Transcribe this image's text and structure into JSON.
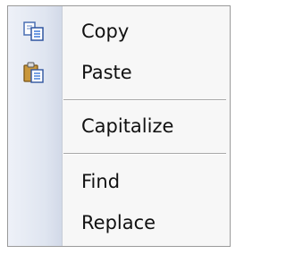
{
  "context_menu": {
    "items": [
      {
        "label": "Copy",
        "icon": "copy-icon"
      },
      {
        "label": "Paste",
        "icon": "paste-icon"
      },
      {
        "label": "Capitalize",
        "icon": ""
      },
      {
        "label": "Find",
        "icon": ""
      },
      {
        "label": "Replace",
        "icon": ""
      }
    ]
  },
  "colors": {
    "menu_background": "#f7f7f7",
    "gutter": "#dfe5f0",
    "border": "#9a9a9a",
    "separator": "#a8a8a8",
    "text": "#111111"
  }
}
